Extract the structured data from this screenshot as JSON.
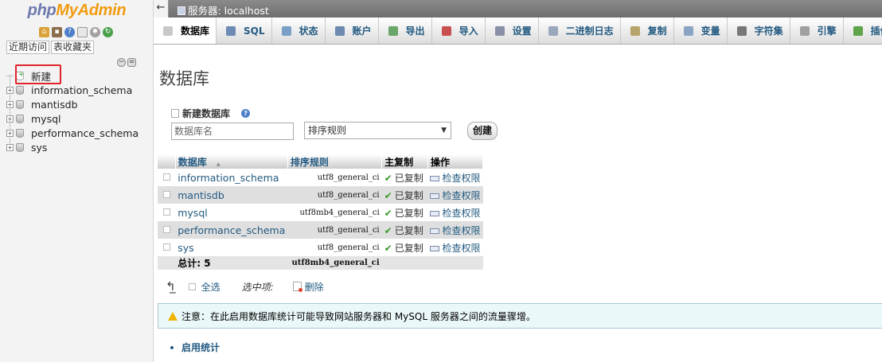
{
  "logo": {
    "part1": "php",
    "part2": "MyAdmin"
  },
  "nav": {
    "tabs": [
      "近期访问",
      "表收藏夹"
    ],
    "new_item": "新建",
    "databases": [
      "information_schema",
      "mantisdb",
      "mysql",
      "performance_schema",
      "sys"
    ]
  },
  "topbar": {
    "back": "←",
    "server": "服务器: localhost"
  },
  "tabs": [
    {
      "label": "数据库",
      "icon": "database-icon",
      "color": "#c8c8c8"
    },
    {
      "label": "SQL",
      "icon": "sql-icon",
      "color": "#6e8bb6"
    },
    {
      "label": "状态",
      "icon": "status-icon",
      "color": "#7aa0c8"
    },
    {
      "label": "账户",
      "icon": "users-icon",
      "color": "#6d8ab0"
    },
    {
      "label": "导出",
      "icon": "export-icon",
      "color": "#6aa56a"
    },
    {
      "label": "导入",
      "icon": "import-icon",
      "color": "#c85050"
    },
    {
      "label": "设置",
      "icon": "wrench-icon",
      "color": "#8a8fa8"
    },
    {
      "label": "二进制日志",
      "icon": "binlog-icon",
      "color": "#9aa8bd"
    },
    {
      "label": "复制",
      "icon": "replication-icon",
      "color": "#b7a46a"
    },
    {
      "label": "变量",
      "icon": "variables-icon",
      "color": "#8aa4c4"
    },
    {
      "label": "字符集",
      "icon": "charset-icon",
      "color": "#777777"
    },
    {
      "label": "引擎",
      "icon": "engine-icon",
      "color": "#a0a0a0"
    },
    {
      "label": "插件",
      "icon": "plugin-icon",
      "color": "#5fa34a"
    }
  ],
  "page_title": "数据库",
  "create": {
    "title": "新建数据库",
    "name_placeholder": "数据库名",
    "collation_placeholder": "排序规则",
    "button": "创建"
  },
  "table": {
    "headers": {
      "database": "数据库",
      "sort_arrow": "▲",
      "collation": "排序规则",
      "master_replication": "主复制",
      "action": "操作"
    },
    "rows": [
      {
        "name": "information_schema",
        "collation": "utf8_general_ci",
        "replication": "已复制",
        "action": "检查权限"
      },
      {
        "name": "mantisdb",
        "collation": "utf8_general_ci",
        "replication": "已复制",
        "action": "检查权限"
      },
      {
        "name": "mysql",
        "collation": "utf8mb4_general_ci",
        "replication": "已复制",
        "action": "检查权限"
      },
      {
        "name": "performance_schema",
        "collation": "utf8_general_ci",
        "replication": "已复制",
        "action": "检查权限"
      },
      {
        "name": "sys",
        "collation": "utf8_general_ci",
        "replication": "已复制",
        "action": "检查权限"
      }
    ],
    "total_label": "总计: 5",
    "total_collation": "utf8mb4_general_ci"
  },
  "footer": {
    "select_all": "全选",
    "with_selected": "选中项:",
    "drop": "删除",
    "notice": "注意：在此启用数据库统计可能导致网站服务器和 MySQL 服务器之间的流量骤增。",
    "enable_stats": "启用统计"
  }
}
